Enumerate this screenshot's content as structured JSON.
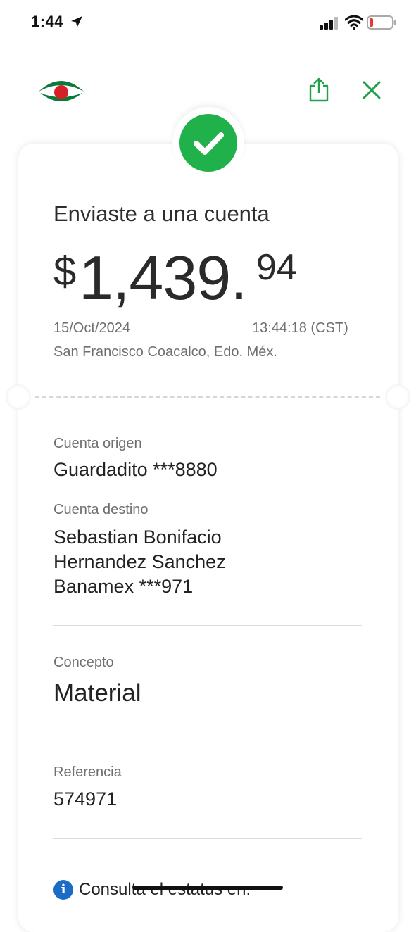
{
  "status_bar": {
    "time": "1:44",
    "icons": [
      "location-arrow-icon",
      "signal-icon",
      "wifi-icon",
      "battery-low-icon"
    ]
  },
  "header": {
    "logo_icon": "bank-logo-icon",
    "share_icon": "share-icon",
    "close_icon": "close-icon",
    "accent_color": "#21a14a"
  },
  "receipt": {
    "status_icon": "check-icon",
    "title": "Enviaste a una cuenta",
    "amount": {
      "currency": "$",
      "integer": "1,439.",
      "cents": "94"
    },
    "date": "15/Oct/2024",
    "time": "13:44:18 (CST)",
    "location": "San Francisco Coacalco, Edo. Méx."
  },
  "details": {
    "origin_label": "Cuenta origen",
    "origin_value": "Guardadito ***8880",
    "destination_label": "Cuenta destino",
    "destination_lines": [
      "Sebastian Bonifacio",
      "Hernandez Sanchez",
      "Banamex ***971"
    ],
    "concept_label": "Concepto",
    "concept_value": "Material",
    "reference_label": "Referencia",
    "reference_value": "574971"
  },
  "footer": {
    "info_icon": "info-icon",
    "info_glyph": "i",
    "info_text": "Consulta el estatus en:"
  },
  "colors": {
    "success": "#21b14b",
    "info": "#1b6cc4",
    "logo_red": "#d62027",
    "logo_green": "#0a7a3a"
  }
}
